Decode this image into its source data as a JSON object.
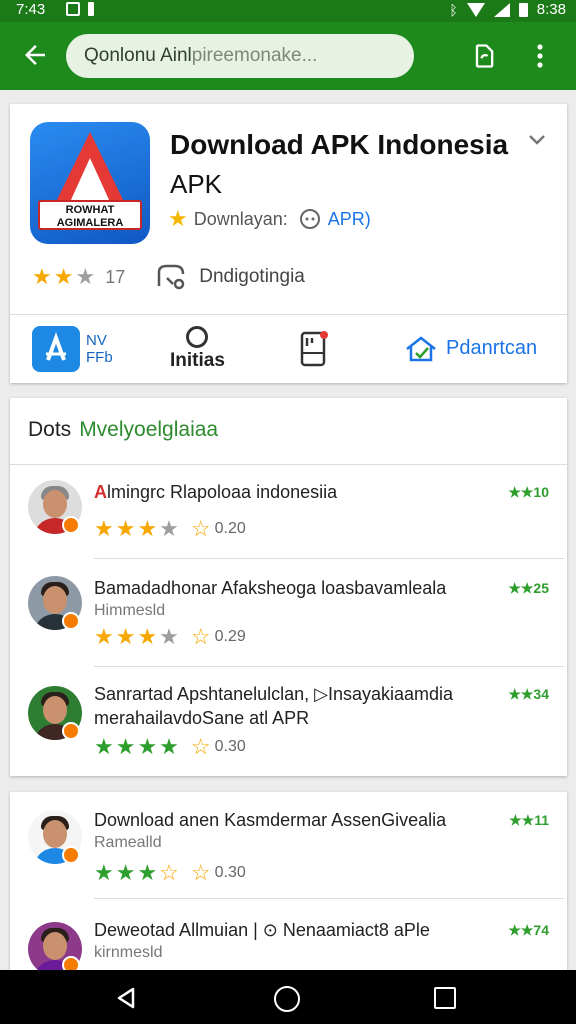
{
  "status_bar": {
    "time": "7:43",
    "clock_right": "8:38",
    "icons": [
      "image-icon",
      "card-icon",
      "bluetooth-icon",
      "wifi-icon",
      "signal-icon",
      "battery-icon"
    ]
  },
  "app_bar": {
    "search_text": "Qonlonu Ainl",
    "search_placeholder": "pireemonake...",
    "icons": [
      "back-arrow-icon",
      "share-icon",
      "more-vert-icon"
    ]
  },
  "app": {
    "icon_text": "ROWHAT AGIMALERA",
    "title": "Download APK Indonesia",
    "title_line2": "APK",
    "meta_label": "Downlayan:",
    "meta_apk": "APR)",
    "rating_count": "17",
    "developer": "Dndigotingia",
    "rating_stars": 2
  },
  "actions": [
    {
      "label_1": "NV",
      "label_2": "FFb",
      "icon": "app-store-icon"
    },
    {
      "label": "Initias",
      "icon": "circle-icon"
    },
    {
      "icon": "clipboard-icon"
    },
    {
      "label": "Pdanrtcan",
      "icon": "house-check-icon"
    }
  ],
  "reviews_header": {
    "title": "Dots",
    "subtitle": "Mvelyoelglaiaa"
  },
  "reviews": [
    {
      "title_prefix": "A",
      "title": "lmingrc Rlapoloaa indonesiia",
      "subtitle": "",
      "stars": 3,
      "score": "0.20",
      "badge": "★★10"
    },
    {
      "title": "Bamadadhonar Afaksheoga loasbavamleala",
      "subtitle": "Himmesld",
      "stars": 3,
      "score": "0.29",
      "badge": "★★25"
    },
    {
      "title": "Sanrartad Apshtanelulclan, ▷Insayakiaamdia",
      "title_line2": "merahailavdoSane atl APR",
      "stars": 4,
      "score": "0.30",
      "badge": "★★34"
    }
  ],
  "reviews2": [
    {
      "title": "Download anen Kasmdermar AssenGivealia",
      "subtitle": "Ramealld",
      "stars": 3,
      "score": "0.30",
      "badge": "★★11"
    },
    {
      "title": "Deweotad Allmuian | ⊙ Nenaamiact8 aPle",
      "subtitle": "kirnmesld",
      "badge": "★★74"
    }
  ],
  "colors": {
    "status_bar": "#1b7a17",
    "app_bar": "#1f8a1c",
    "accent_blue": "#1a73e8",
    "star_gold": "#f6a800",
    "star_green": "#2e9e2e"
  }
}
